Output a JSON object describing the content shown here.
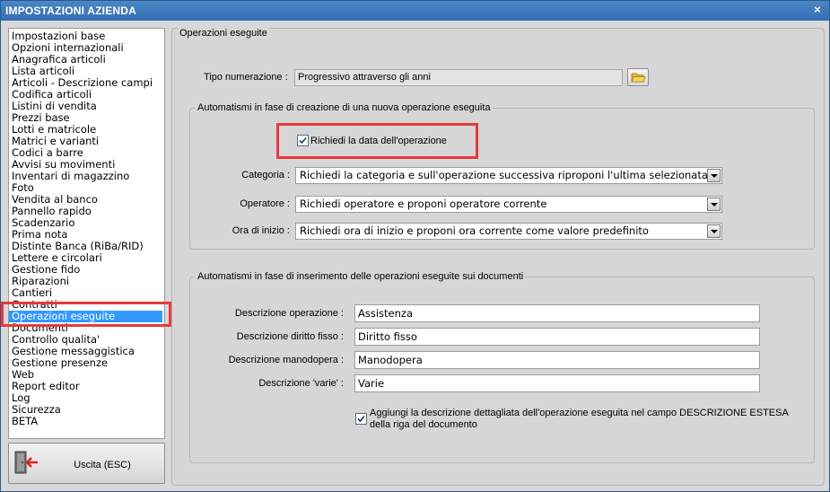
{
  "window": {
    "title": "IMPOSTAZIONI AZIENDA",
    "close_symbol": "×"
  },
  "sidebar": {
    "items": [
      {
        "label": "Impostazioni base"
      },
      {
        "label": "Opzioni internazionali"
      },
      {
        "label": "Anagrafica articoli"
      },
      {
        "label": "Lista articoli"
      },
      {
        "label": "Articoli - Descrizione campi"
      },
      {
        "label": "Codifica articoli"
      },
      {
        "label": "Listini di vendita"
      },
      {
        "label": "Prezzi base"
      },
      {
        "label": "Lotti e matricole"
      },
      {
        "label": "Matrici e varianti"
      },
      {
        "label": "Codici a barre"
      },
      {
        "label": "Avvisi su movimenti"
      },
      {
        "label": "Inventari di magazzino"
      },
      {
        "label": "Foto"
      },
      {
        "label": "Vendita al banco"
      },
      {
        "label": "Pannello rapido"
      },
      {
        "label": "Scadenzario"
      },
      {
        "label": "Prima nota"
      },
      {
        "label": "Distinte Banca (RiBa/RID)"
      },
      {
        "label": "Lettere e circolari"
      },
      {
        "label": "Gestione fido"
      },
      {
        "label": "Riparazioni"
      },
      {
        "label": "Cantieri"
      },
      {
        "label": "Contratti"
      },
      {
        "label": "Operazioni eseguite"
      },
      {
        "label": "Documenti"
      },
      {
        "label": "Controllo qualita'"
      },
      {
        "label": "Gestione messaggistica"
      },
      {
        "label": "Gestione presenze"
      },
      {
        "label": "Web"
      },
      {
        "label": "Report editor"
      },
      {
        "label": "Log"
      },
      {
        "label": "Sicurezza"
      },
      {
        "label": "BETA"
      }
    ],
    "selected_label": "Operazioni eseguite",
    "exit_label": "Uscita (ESC)"
  },
  "panel": {
    "title": "Operazioni eseguite",
    "numbering": {
      "label": "Tipo numerazione :",
      "value": "Progressivo attraverso gli anni"
    },
    "group_creation": {
      "title": "Automatismi in fase di creazione di una nuova operazione eseguita",
      "ask_date_label": "Richiedi la data dell'operazione",
      "ask_date_checked": true,
      "category_label": "Categoria :",
      "category_value": "Richiedi la categoria e sull'operazione successiva riproponi l'ultima selezionata",
      "operator_label": "Operatore :",
      "operator_value": "Richiedi operatore e proponi operatore corrente",
      "start_time_label": "Ora di inizio :",
      "start_time_value": "Richiedi ora di inizio e proponi ora corrente come valore predefinito"
    },
    "group_insert": {
      "title": "Automatismi in fase di inserimento delle operazioni eseguite sui documenti",
      "desc_operation_label": "Descrizione operazione :",
      "desc_operation_value": "Assistenza",
      "desc_fixed_fee_label": "Descrizione diritto fisso :",
      "desc_fixed_fee_value": "Diritto fisso",
      "desc_labour_label": "Descrizione manodopera :",
      "desc_labour_value": "Manodopera",
      "desc_misc_label": "Descrizione 'varie' :",
      "desc_misc_value": "Varie",
      "add_detail_line1": "Aggiungi la descrizione dettagliata dell'operazione eseguita nel campo DESCRIZIONE ESTESA",
      "add_detail_line2": "della riga del documento",
      "add_detail_checked": true
    }
  },
  "colors": {
    "titlebar": "#3570b4",
    "selection": "#3399ff",
    "highlight": "#e8393e"
  }
}
